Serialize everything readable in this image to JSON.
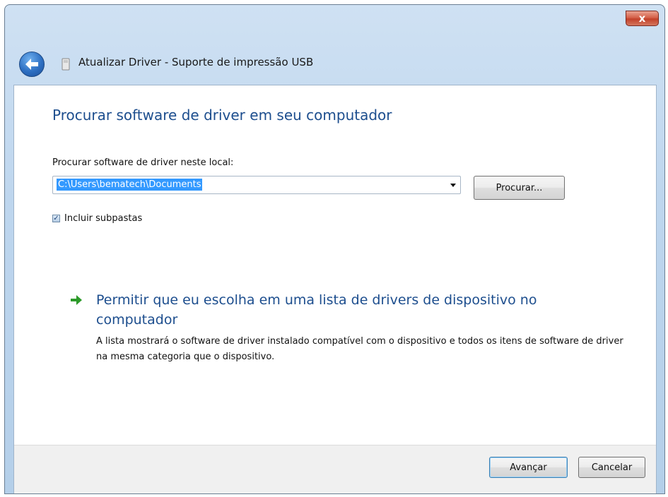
{
  "window": {
    "title": "Atualizar Driver - Suporte de impressão USB",
    "close_label": "x"
  },
  "page": {
    "heading": "Procurar software de driver em seu computador",
    "location_label": "Procurar software de driver neste local:",
    "location_value": "C:\\Users\\bematech\\Documents",
    "browse_label": "Procurar...",
    "include_subfolders_label": "Incluir subpastas",
    "include_subfolders_checked": true,
    "option_title": "Permitir que eu escolha em uma lista de drivers de dispositivo no computador",
    "option_desc": "A lista mostrará o software de driver instalado compatível com o dispositivo e todos os itens de software de driver na mesma categoria que o dispositivo."
  },
  "footer": {
    "next_label": "Avançar",
    "cancel_label": "Cancelar"
  },
  "colors": {
    "heading": "#1d4e8e",
    "selection": "#3399ff",
    "arrow": "#2d9a2a"
  },
  "icons": {
    "back": "back-arrow-icon",
    "device": "usb-device-icon",
    "option": "green-arrow-icon",
    "close": "close-icon"
  }
}
